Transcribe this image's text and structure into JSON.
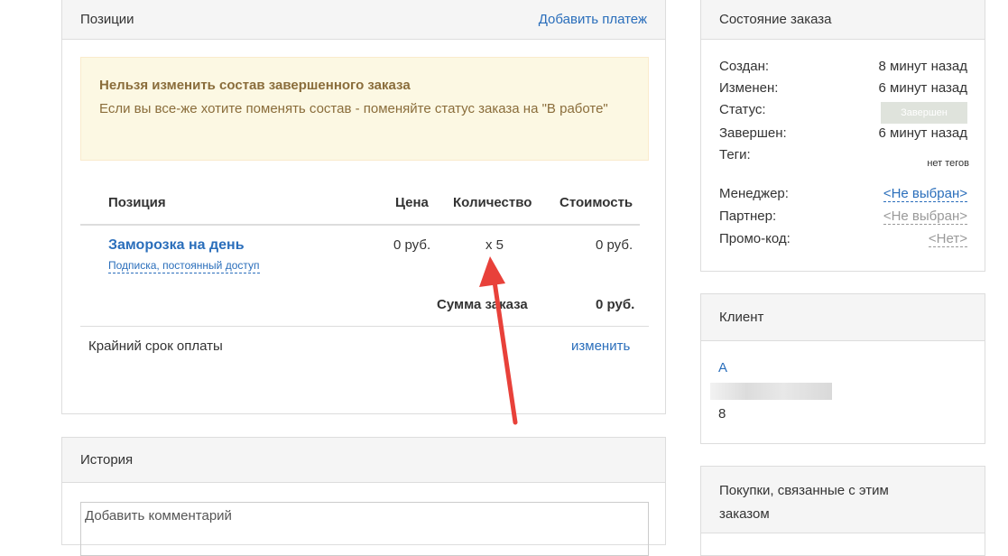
{
  "positions": {
    "title": "Позиции",
    "add_payment": "Добавить платеж",
    "warning": {
      "title": "Нельзя изменить состав завершенного заказа",
      "text": "Если вы все-же хотите поменять состав - поменяйте статус заказа на \"В работе\""
    },
    "columns": [
      "Позиция",
      "Цена",
      "Количество",
      "Стоимость"
    ],
    "item": {
      "name": "Заморозка на день",
      "subtitle": "Подписка, постоянный доступ",
      "price": "0 руб.",
      "qty": "x 5",
      "cost": "0 руб."
    },
    "sum_label": "Сумма заказа",
    "sum_value": "0 руб.",
    "deadline_label": "Крайний срок оплаты",
    "deadline_change": "изменить"
  },
  "history": {
    "title": "История",
    "comment_placeholder": "Добавить комментарий"
  },
  "order_status": {
    "title": "Состояние заказа",
    "created_label": "Создан:",
    "created_value": "8 минут назад",
    "changed_label": "Изменен:",
    "changed_value": "6 минут назад",
    "status_label": "Статус:",
    "status_value": "Завершен",
    "finished_label": "Завершен:",
    "finished_value": "6 минут назад",
    "tags_label": "Теги:",
    "tags_value": "нет тегов",
    "manager_label": "Менеджер:",
    "manager_value": "<Не выбран>",
    "partner_label": "Партнер:",
    "partner_value": "<Не выбран>",
    "promo_label": "Промо-код:",
    "promo_value": "<Нет>"
  },
  "client": {
    "title": "Клиент",
    "name": "А",
    "number": "8"
  },
  "purchases": {
    "title": "Покупки, связанные с этим заказом"
  },
  "colors": {
    "link": "#2a6ebb",
    "warning_bg": "#fcf8e3",
    "warning_text": "#8a6d3b",
    "annotation_arrow": "#e8413a"
  }
}
